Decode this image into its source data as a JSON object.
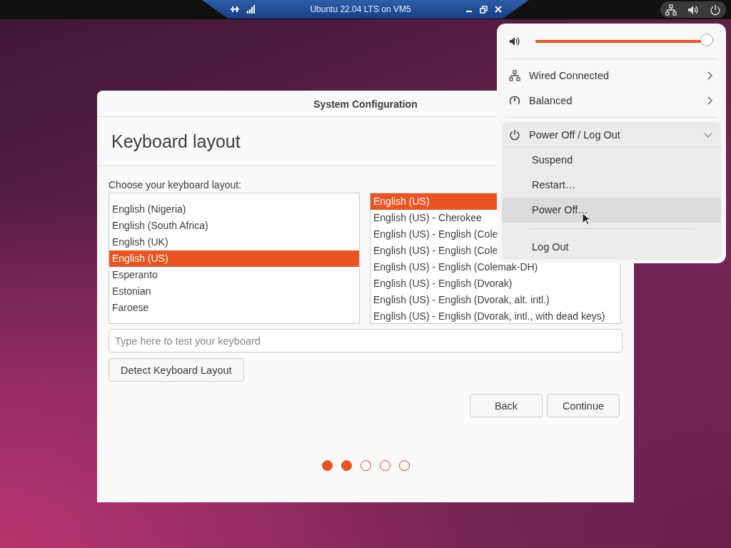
{
  "vm_bar": {
    "title": "Ubuntu 22.04 LTS on VM5"
  },
  "dialog": {
    "title": "System Configuration",
    "heading": "Keyboard layout",
    "prompt": "Choose your keyboard layout:",
    "layouts": [
      {
        "label": "English (Nigeria)",
        "selected": false
      },
      {
        "label": "English (South Africa)",
        "selected": false
      },
      {
        "label": "English (UK)",
        "selected": false
      },
      {
        "label": "English (US)",
        "selected": true
      },
      {
        "label": "Esperanto",
        "selected": false
      },
      {
        "label": "Estonian",
        "selected": false
      },
      {
        "label": "Faroese",
        "selected": false
      }
    ],
    "variants": [
      {
        "label": "English (US)",
        "selected": true
      },
      {
        "label": "English (US) - Cherokee",
        "selected": false
      },
      {
        "label": "English (US) - English (Cole",
        "selected": false
      },
      {
        "label": "English (US) - English (Cole",
        "selected": false
      },
      {
        "label": "English (US) - English (Colemak-DH)",
        "selected": false
      },
      {
        "label": "English (US) - English (Dvorak)",
        "selected": false
      },
      {
        "label": "English (US) - English (Dvorak, alt. intl.)",
        "selected": false
      },
      {
        "label": "English (US) - English (Dvorak, intl., with dead keys)",
        "selected": false
      }
    ],
    "test_field": {
      "placeholder": "Type here to test your keyboard"
    },
    "detect_button": "Detect Keyboard Layout",
    "buttons": [
      {
        "label": "Back"
      },
      {
        "label": "Continue"
      }
    ],
    "steps": [
      {
        "done": true
      },
      {
        "done": true
      },
      {
        "done": false
      },
      {
        "done": false
      },
      {
        "done": false
      }
    ]
  },
  "system_menu": {
    "volume": {
      "level": 0.98
    },
    "network": {
      "label": "Wired Connected"
    },
    "power_mode": {
      "label": "Balanced"
    },
    "power": {
      "label": "Power Off / Log Out",
      "expanded": true,
      "options": [
        {
          "label": "Suspend",
          "selected": false
        },
        {
          "label": "Restart…",
          "selected": false
        },
        {
          "label": "Power Off…",
          "selected": true
        },
        {
          "label": "Log Out",
          "selected": false
        }
      ]
    }
  }
}
